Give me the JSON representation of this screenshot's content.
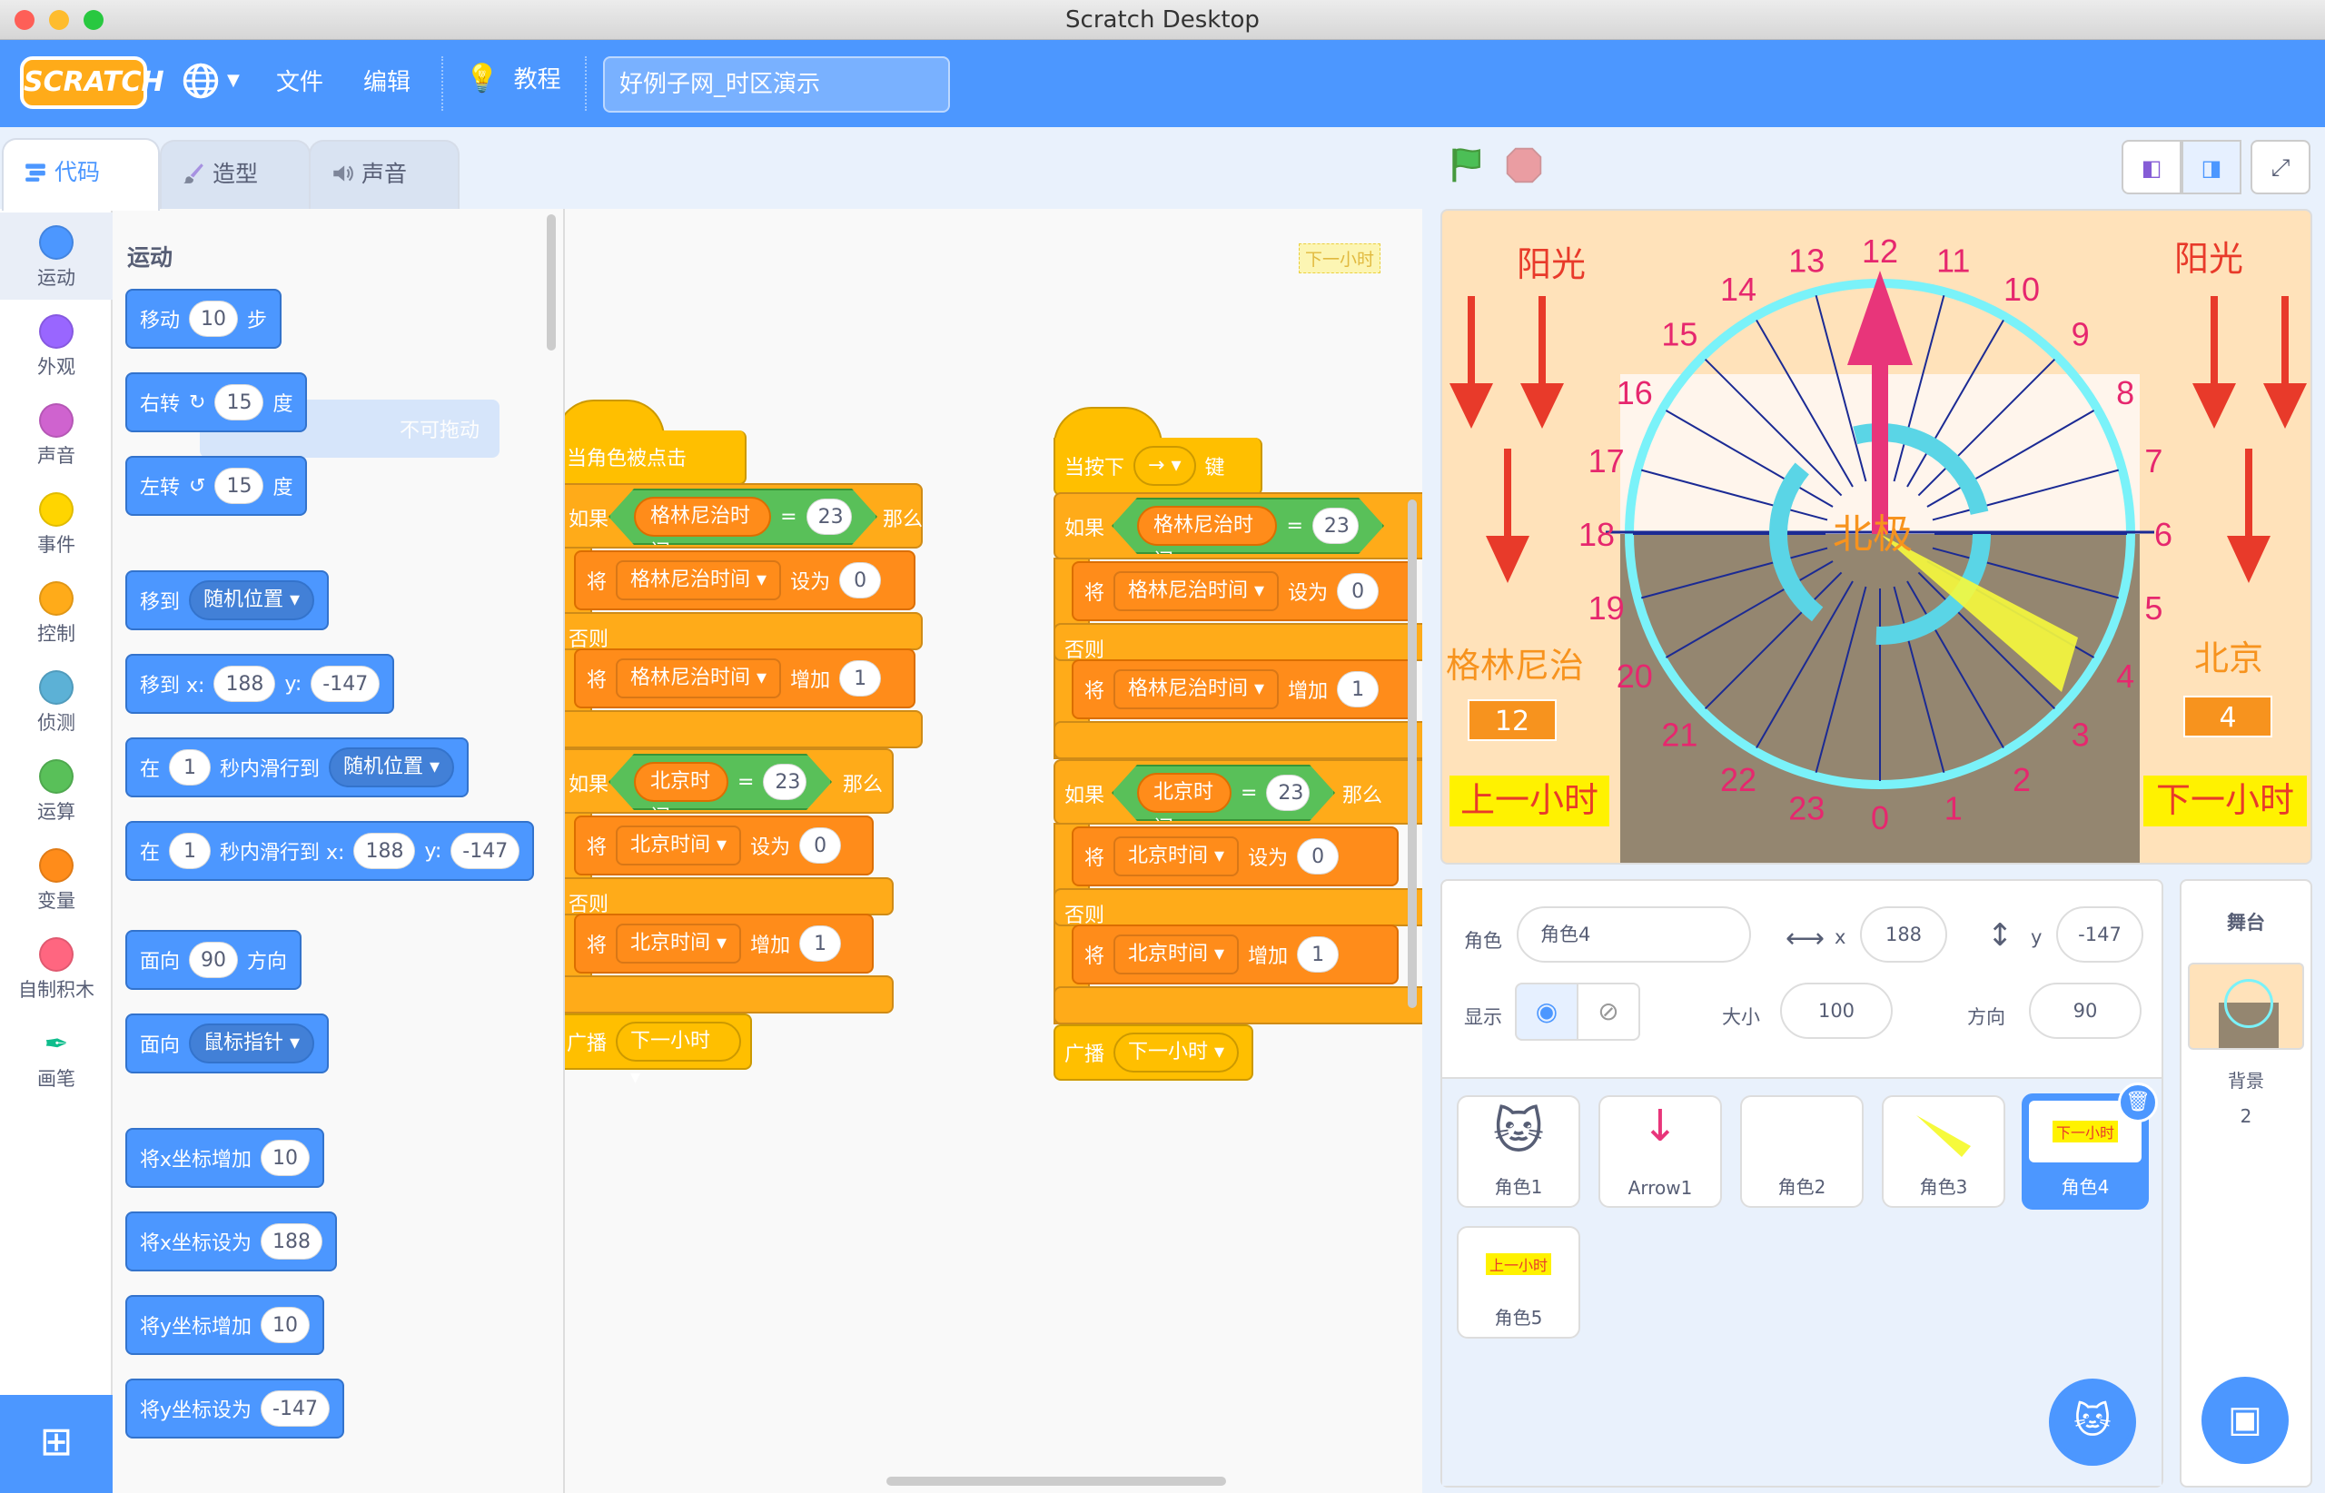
{
  "window": {
    "title": "Scratch Desktop"
  },
  "menu": {
    "logo": "SCRATCH",
    "file": "文件",
    "edit": "编辑",
    "tutorials": "教程",
    "project_title": "好例子网_时区演示"
  },
  "tabs": {
    "code": "代码",
    "costumes": "造型",
    "sounds": "声音"
  },
  "categories": [
    "运动",
    "外观",
    "声音",
    "事件",
    "控制",
    "侦测",
    "运算",
    "变量",
    "自制积木",
    "画笔"
  ],
  "category_colors": [
    "#4c97ff",
    "#9966ff",
    "#cf63cf",
    "#ffd500",
    "#ffab19",
    "#5cb1d6",
    "#59c059",
    "#ff8c1a",
    "#ff6680",
    "#0fbd8c"
  ],
  "palette": {
    "heading": "运动",
    "move": {
      "label": "移动",
      "value": "10",
      "suffix": "步"
    },
    "turn_right": {
      "label": "右转",
      "value": "15",
      "suffix": "度"
    },
    "turn_left": {
      "label": "左转",
      "value": "15",
      "suffix": "度"
    },
    "goto": {
      "label": "移到",
      "menu": "随机位置"
    },
    "goto_xy": {
      "label": "移到 x:",
      "x": "188",
      "ylabel": "y:",
      "y": "-147"
    },
    "glide": {
      "label": "在",
      "secs": "1",
      "mid": "秒内滑行到",
      "menu": "随机位置"
    },
    "glide_xy": {
      "label": "在",
      "secs": "1",
      "mid": "秒内滑行到 x:",
      "x": "188",
      "ylabel": "y:",
      "y": "-147"
    },
    "point_dir": {
      "label": "面向",
      "value": "90",
      "suffix": "方向"
    },
    "point_towards": {
      "label": "面向",
      "menu": "鼠标指针"
    },
    "change_x": {
      "label": "将x坐标增加",
      "value": "10"
    },
    "set_x": {
      "label": "将x坐标设为",
      "value": "188"
    },
    "change_y": {
      "label": "将y坐标增加",
      "value": "10"
    },
    "set_y": {
      "label": "将y坐标设为",
      "value": "-147"
    },
    "ghost_text": "不可拖动"
  },
  "scripts": {
    "comment": "下一小时",
    "left": {
      "hat": "当角色被点击",
      "if": "如果",
      "then": "那么",
      "else": "否则",
      "var1": "格林尼治时间",
      "eq": "=",
      "num": "23",
      "set": "将",
      "set_to": "设为",
      "zero": "0",
      "change": "增加",
      "one": "1",
      "var2": "北京时间",
      "broadcast": "广播",
      "msg": "下一小时"
    },
    "right": {
      "hat": "当按下",
      "key": "→",
      "key_suffix": "键",
      "if": "如果",
      "then": "那么",
      "else": "否则",
      "var1": "格林尼治时间",
      "eq": "=",
      "num": "23",
      "set": "将",
      "set_to": "设为",
      "zero": "0",
      "change": "增加",
      "one": "1",
      "var2": "北京时间",
      "broadcast": "广播",
      "msg": "下一小时"
    }
  },
  "stage": {
    "sunlight_left": "阳光",
    "sunlight_right": "阳光",
    "north_pole": "北极",
    "greenwich_label": "格林尼治",
    "greenwich_value": "12",
    "beijing_label": "北京",
    "beijing_value": "4",
    "prev_hour": "上一小时",
    "next_hour": "下一小时",
    "hours": [
      "12",
      "11",
      "10",
      "9",
      "8",
      "7",
      "6",
      "5",
      "4",
      "3",
      "2",
      "1",
      "0",
      "23",
      "22",
      "21",
      "20",
      "19",
      "18",
      "17",
      "16",
      "15",
      "14",
      "13"
    ]
  },
  "sprite_info": {
    "sprite_label": "角色",
    "sprite_name": "角色4",
    "x_label": "x",
    "x": "188",
    "y_label": "y",
    "y": "-147",
    "show_label": "显示",
    "size_label": "大小",
    "size": "100",
    "direction_label": "方向",
    "direction": "90"
  },
  "sprites": [
    {
      "name": "角色1"
    },
    {
      "name": "Arrow1"
    },
    {
      "name": "角色2"
    },
    {
      "name": "角色3"
    },
    {
      "name": "角色4",
      "thumb": "下一小时"
    },
    {
      "name": "角色5",
      "thumb": "上一小时"
    }
  ],
  "stage_pane": {
    "title": "舞台",
    "backdrop_label": "背景",
    "backdrop_count": "2"
  },
  "colors": {
    "motion": "#4c97ff",
    "menubar": "#4c97ff",
    "control": "#ffab19",
    "variables": "#ff8c1a",
    "operators": "#59c059",
    "events": "#ffbf00"
  }
}
